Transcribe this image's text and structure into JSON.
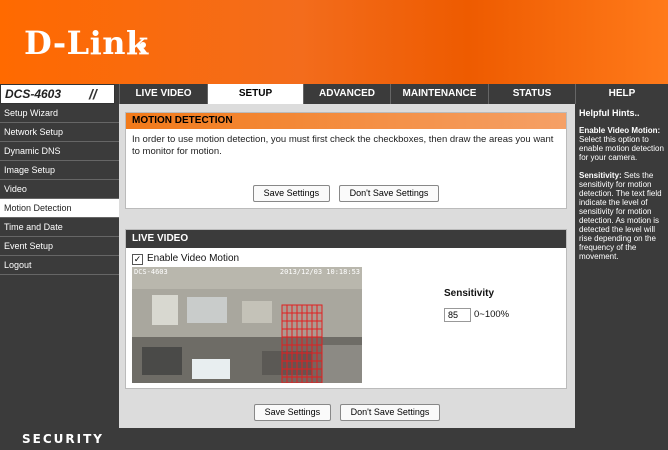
{
  "brand": {
    "logo": "D-Link"
  },
  "model": "DCS-4603",
  "tabs": [
    "LIVE VIDEO",
    "SETUP",
    "ADVANCED",
    "MAINTENANCE",
    "STATUS",
    "HELP"
  ],
  "active_tab": "SETUP",
  "sidebar": {
    "items": [
      "Setup Wizard",
      "Network Setup",
      "Dynamic DNS",
      "Image Setup",
      "Video",
      "Motion Detection",
      "Time and Date",
      "Event Setup",
      "Logout"
    ],
    "active": "Motion Detection"
  },
  "motion": {
    "title": "MOTION DETECTION",
    "description": "In order to use motion detection, you must first check the checkboxes, then draw the areas you want to monitor for motion.",
    "save_label": "Save Settings",
    "dont_save_label": "Don't Save Settings"
  },
  "live": {
    "title": "LIVE VIDEO",
    "enable_label": "Enable Video Motion",
    "enable_checked": true,
    "osd_left": "DCS-4603",
    "osd_right": "2013/12/03 10:18:53",
    "sensitivity_label": "Sensitivity",
    "sensitivity_value": "85",
    "sensitivity_range": "0~100%"
  },
  "bottom": {
    "save_label": "Save Settings",
    "dont_save_label": "Don't Save Settings"
  },
  "hints": {
    "title": "Helpful Hints..",
    "h1": "Enable Video Motion:",
    "t1": "Select this option to enable motion detection for your camera.",
    "h2": "Sensitivity:",
    "t2": "Sets the sensitivity for motion detection. The text field indicate the level of sensitivity for motion detection. As motion is detected the level will rise depending on the frequency of the movement."
  },
  "footer": "SECURITY",
  "colors": {
    "accent": "#f36c1c",
    "dark": "#3b3b3b",
    "grid": "#e02020"
  }
}
